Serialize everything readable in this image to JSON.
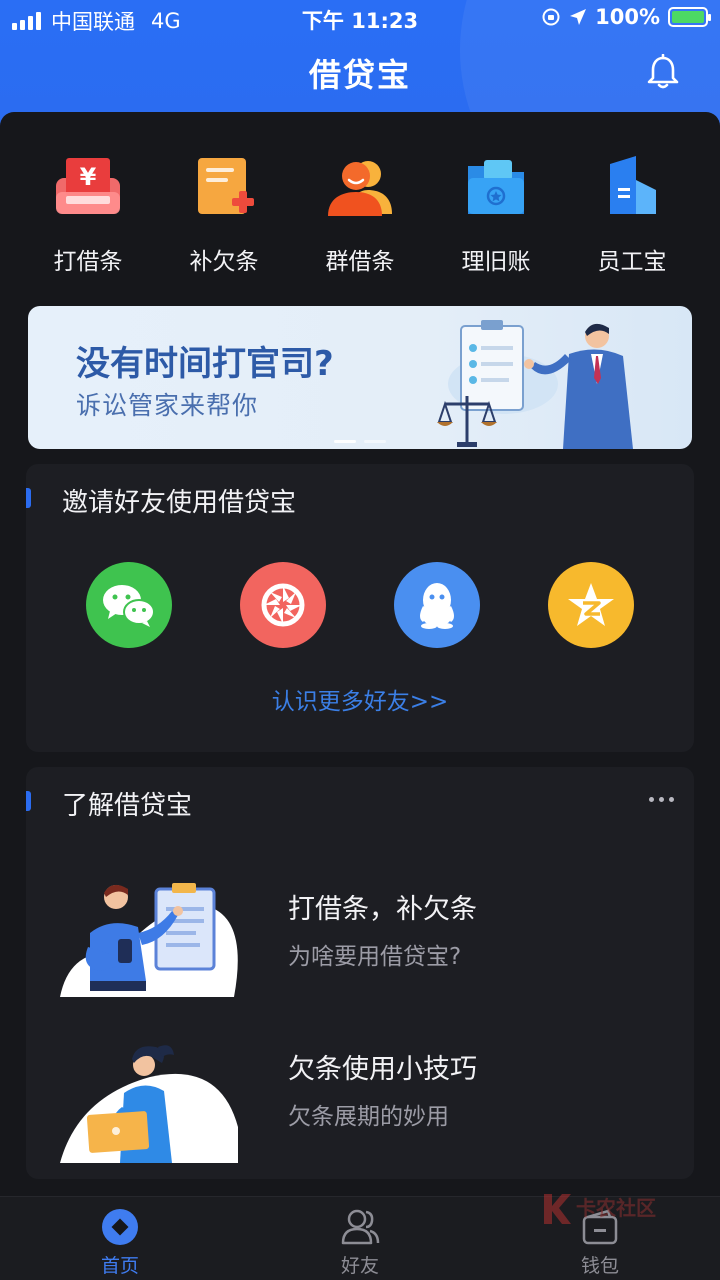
{
  "status": {
    "carrier": "中国联通",
    "network": "4G",
    "time": "下午 11:23",
    "battery": "100%"
  },
  "header": {
    "title": "借贷宝"
  },
  "quick_actions": [
    {
      "label": "打借条",
      "icon": "iou-icon"
    },
    {
      "label": "补欠条",
      "icon": "debt-note-add-icon"
    },
    {
      "label": "群借条",
      "icon": "group-iou-icon"
    },
    {
      "label": "理旧账",
      "icon": "folder-account-icon"
    },
    {
      "label": "员工宝",
      "icon": "employee-icon"
    }
  ],
  "banner": {
    "headline": "没有时间打官司?",
    "subline": "诉讼管家来帮你"
  },
  "invite": {
    "title": "邀请好友使用借贷宝",
    "share_targets": [
      "wechat-icon",
      "moments-icon",
      "qq-icon",
      "qzone-icon"
    ],
    "more_link": "认识更多好友>>"
  },
  "learn": {
    "title": "了解借贷宝",
    "articles": [
      {
        "title": "打借条，补欠条",
        "subtitle": "为啥要用借贷宝?"
      },
      {
        "title": "欠条使用小技巧",
        "subtitle": "欠条展期的妙用"
      }
    ]
  },
  "tabs": [
    {
      "label": "首页",
      "active": true
    },
    {
      "label": "好友",
      "active": false
    },
    {
      "label": "钱包",
      "active": false
    }
  ],
  "watermark": {
    "text": "卡农社区"
  },
  "colors": {
    "brand": "#2b6cf0",
    "link": "#3b7fe6",
    "background": "#16171b"
  }
}
